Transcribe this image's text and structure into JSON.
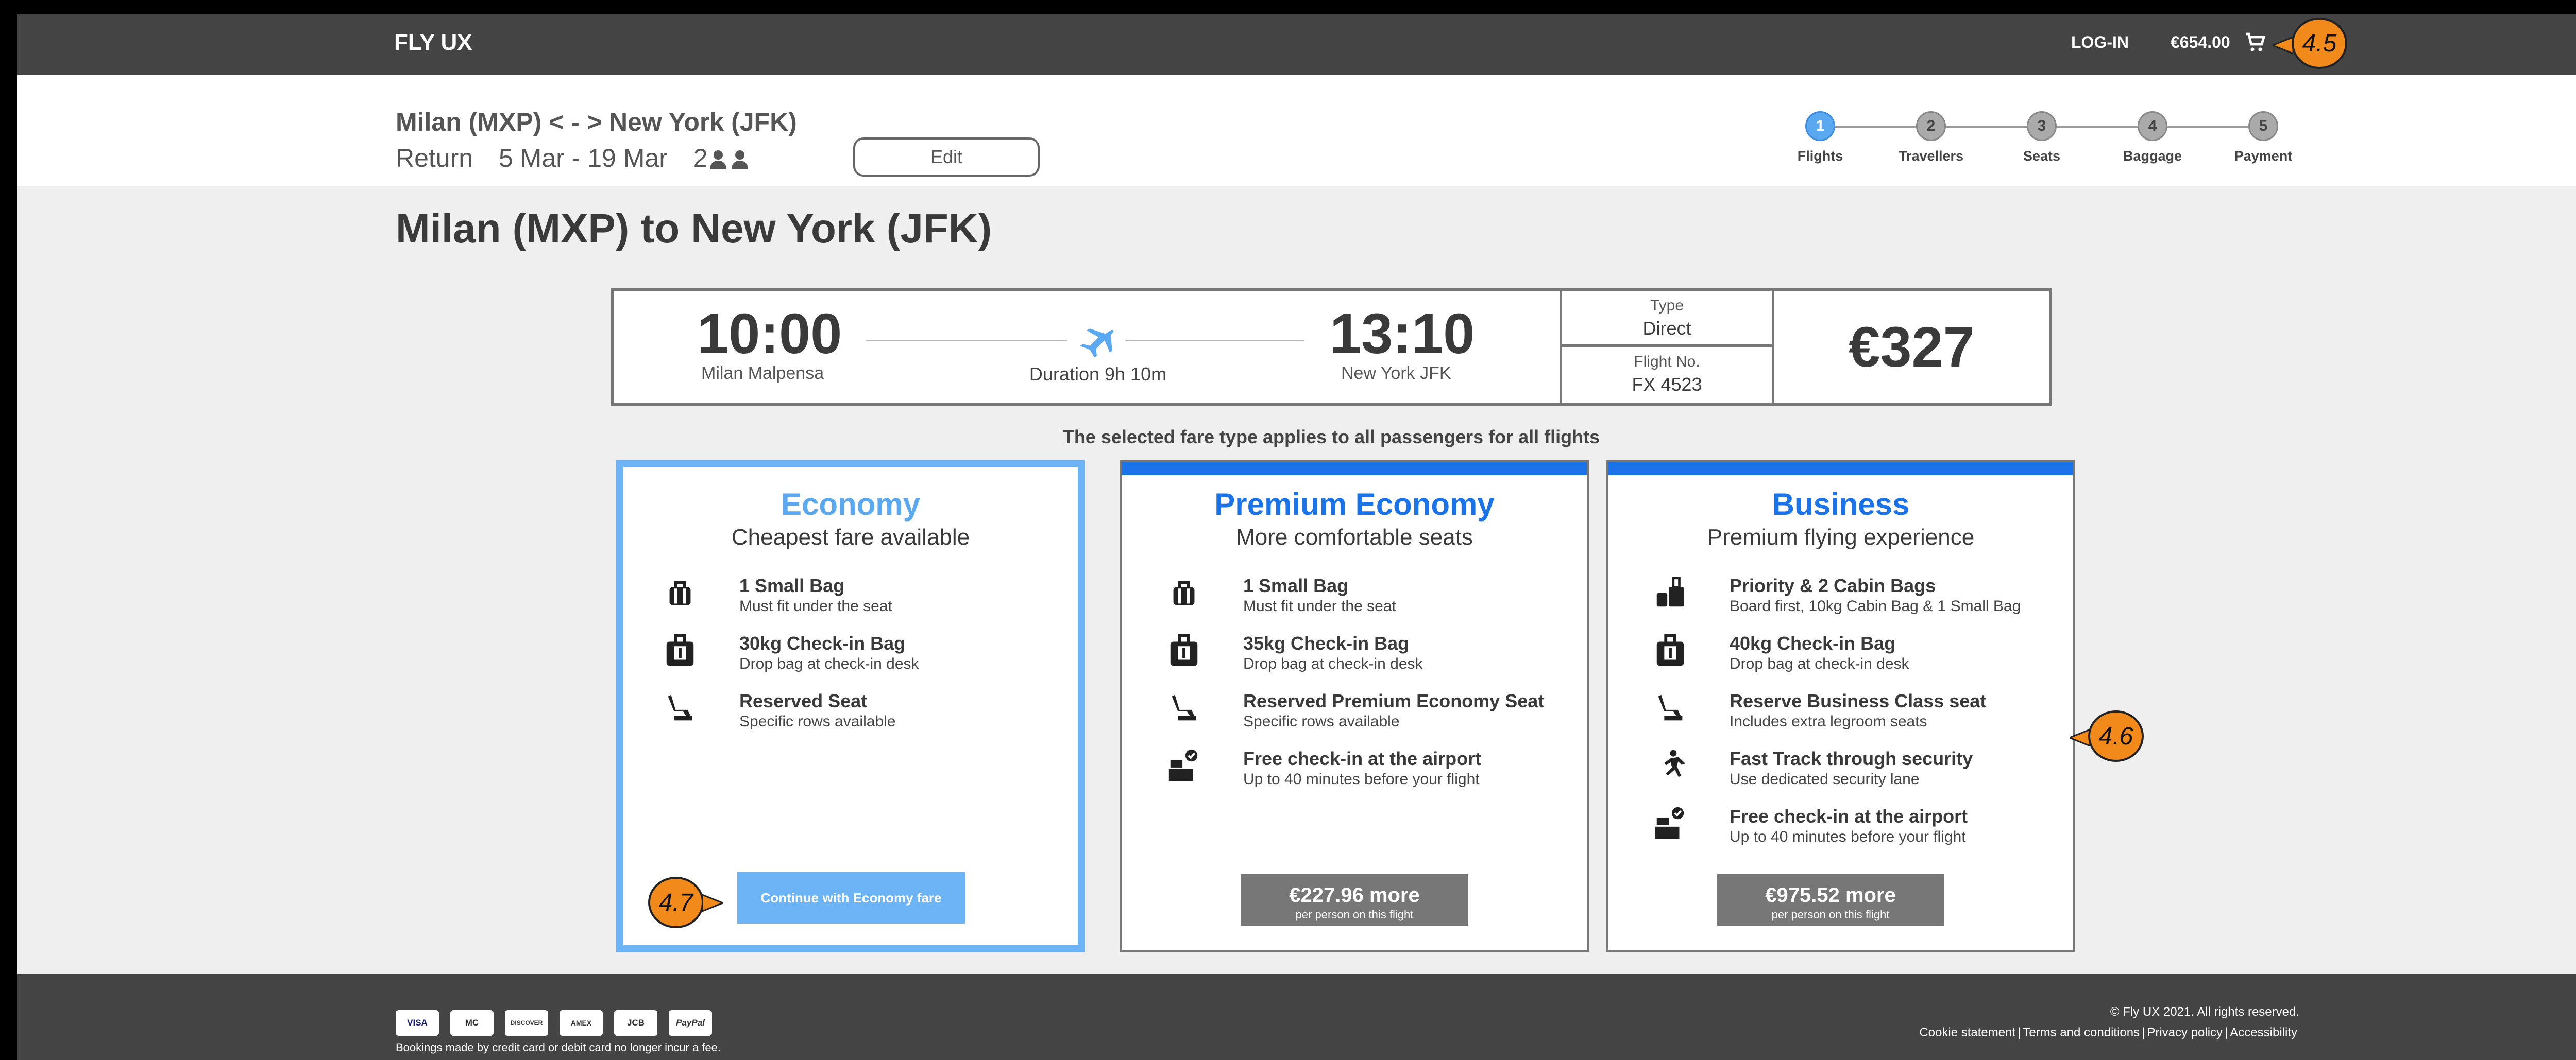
{
  "header": {
    "brand": "FLY UX",
    "login_label": "LOG-IN",
    "cart_total": "€654.00"
  },
  "summary": {
    "route": "Milan (MXP) < - > New York (JFK)",
    "trip_type": "Return",
    "dates": "5 Mar - 19 Mar",
    "passengers": "2",
    "edit_label": "Edit"
  },
  "stepper": {
    "steps": [
      {
        "num": "1",
        "label": "Flights",
        "active": true
      },
      {
        "num": "2",
        "label": "Travellers",
        "active": false
      },
      {
        "num": "3",
        "label": "Seats",
        "active": false
      },
      {
        "num": "4",
        "label": "Baggage",
        "active": false
      },
      {
        "num": "5",
        "label": "Payment",
        "active": false
      }
    ]
  },
  "page_title": "Milan (MXP) to New York (JFK)",
  "flight": {
    "depart_time": "10:00",
    "depart_airport": "Milan Malpensa",
    "duration": "Duration 9h 10m",
    "arrive_time": "13:10",
    "arrive_airport": "New York JFK",
    "type_label": "Type",
    "type_value": "Direct",
    "flight_no_label": "Flight No.",
    "flight_no_value": "FX 4523",
    "price": "€327"
  },
  "fare_note": "The selected fare type applies to all passengers for all flights",
  "fares": [
    {
      "name": "Economy",
      "subtitle": "Cheapest fare available",
      "features": [
        {
          "icon": "small-bag-icon",
          "title": "1 Small Bag",
          "desc": "Must fit under the seat"
        },
        {
          "icon": "checkin-bag-icon",
          "title": "30kg Check-in Bag",
          "desc": "Drop bag at check-in desk"
        },
        {
          "icon": "seat-icon",
          "title": "Reserved Seat",
          "desc": "Specific rows available"
        }
      ],
      "button_label": "Continue with Economy fare"
    },
    {
      "name": "Premium Economy",
      "subtitle": "More comfortable seats",
      "features": [
        {
          "icon": "small-bag-icon",
          "title": "1 Small Bag",
          "desc": "Must fit under the seat"
        },
        {
          "icon": "checkin-bag-icon",
          "title": "35kg Check-in Bag",
          "desc": "Drop bag at check-in desk"
        },
        {
          "icon": "seat-icon",
          "title": "Reserved Premium Economy Seat",
          "desc": "Specific rows available"
        },
        {
          "icon": "checkin-desk-icon",
          "title": "Free check-in at the airport",
          "desc": "Up to 40 minutes before your flight"
        }
      ],
      "button_amount": "€227.96 more",
      "button_sub": "per person on this flight"
    },
    {
      "name": "Business",
      "subtitle": "Premium flying experience",
      "features": [
        {
          "icon": "cabin-bags-icon",
          "title": "Priority & 2 Cabin Bags",
          "desc": "Board first, 10kg Cabin Bag & 1 Small Bag"
        },
        {
          "icon": "checkin-bag-icon",
          "title": "40kg Check-in Bag",
          "desc": "Drop bag at check-in desk"
        },
        {
          "icon": "seat-icon",
          "title": "Reserve Business Class seat",
          "desc": "Includes extra legroom seats"
        },
        {
          "icon": "running-icon",
          "title": "Fast Track through security",
          "desc": "Use dedicated security lane"
        },
        {
          "icon": "checkin-desk-icon",
          "title": "Free check-in at the airport",
          "desc": "Up to 40 minutes before your flight"
        }
      ],
      "button_amount": "€975.52 more",
      "button_sub": "per person on this flight"
    }
  ],
  "footer": {
    "cards": [
      "VISA",
      "MC",
      "DISCOVER",
      "AMEX",
      "JCB",
      "PayPal"
    ],
    "payment_note": "Bookings made by credit card or debit card no longer incur a fee.",
    "copyright": "© Fly UX 2021. All rights reserved.",
    "links": [
      "Cookie statement",
      "Terms and conditions",
      "Privacy policy",
      "Accessibility"
    ]
  },
  "annotations": {
    "cart": "4.5",
    "business": "4.6",
    "economy_button": "4.7"
  },
  "colors": {
    "accent": "#1a73e8",
    "selected": "#6cb4f5",
    "dark_bar": "#444444",
    "annotation": "#f28a1b"
  }
}
